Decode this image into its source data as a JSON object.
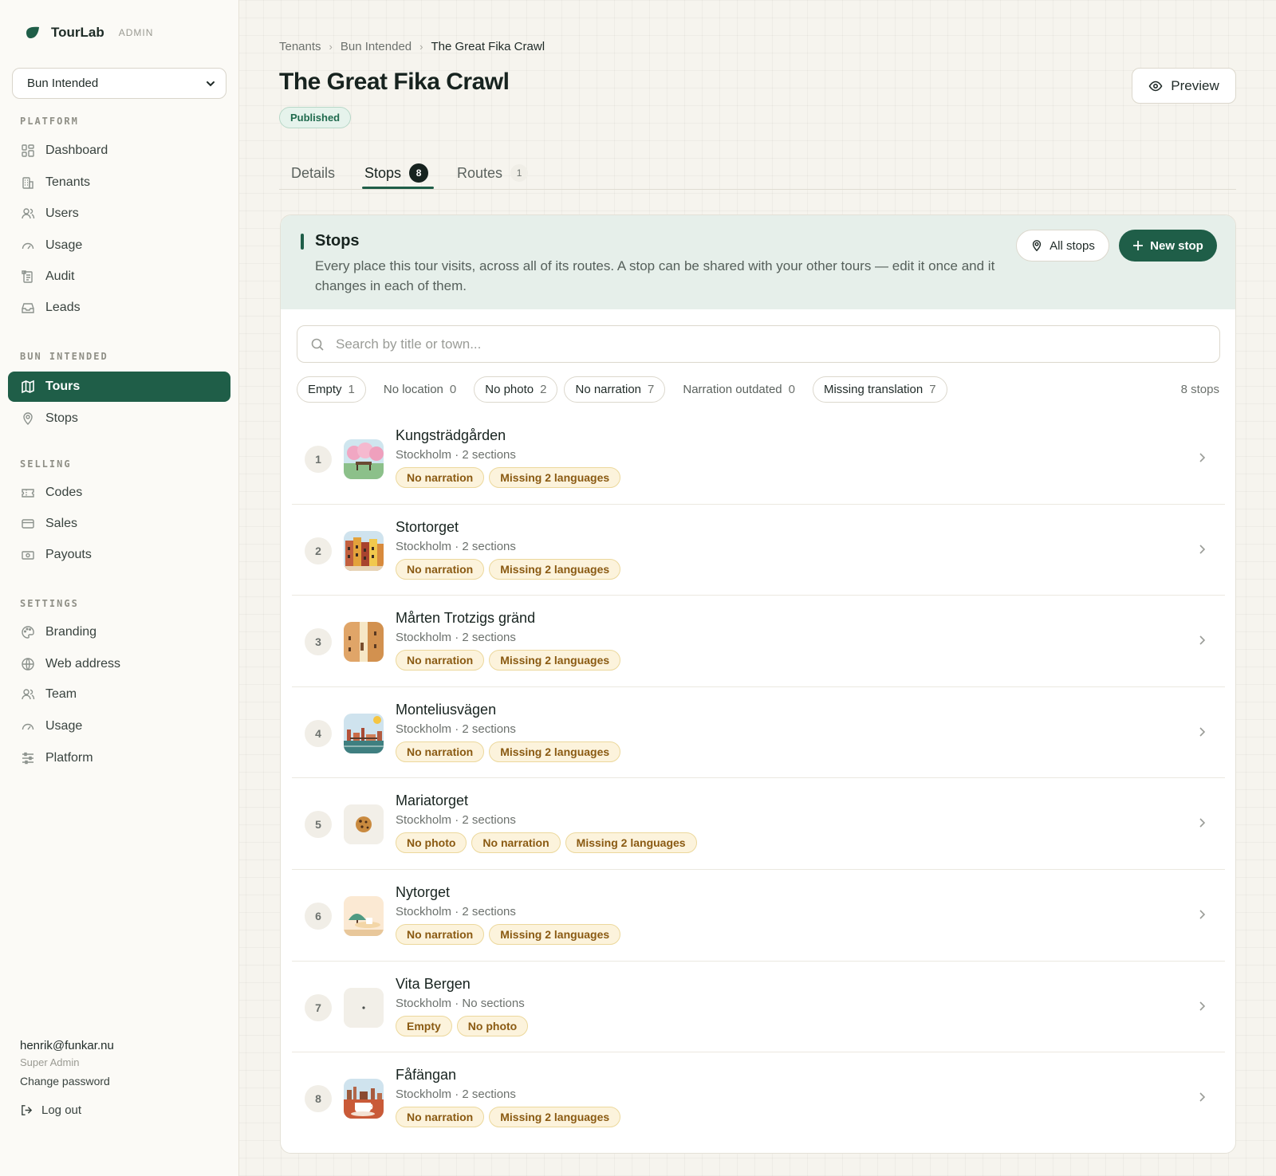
{
  "brand": {
    "name": "TourLab",
    "tag": "ADMIN"
  },
  "tenant_select": {
    "value": "Bun Intended"
  },
  "sidebar": {
    "sections": [
      {
        "label": "PLATFORM",
        "items": [
          {
            "label": "Dashboard",
            "icon": "dashboard-icon"
          },
          {
            "label": "Tenants",
            "icon": "building-icon"
          },
          {
            "label": "Users",
            "icon": "users-icon"
          },
          {
            "label": "Usage",
            "icon": "gauge-icon"
          },
          {
            "label": "Audit",
            "icon": "clipboard-icon"
          },
          {
            "label": "Leads",
            "icon": "inbox-icon"
          }
        ]
      },
      {
        "label": "BUN INTENDED",
        "items": [
          {
            "label": "Tours",
            "icon": "map-icon",
            "active": true
          },
          {
            "label": "Stops",
            "icon": "pin-icon"
          }
        ]
      },
      {
        "label": "SELLING",
        "items": [
          {
            "label": "Codes",
            "icon": "ticket-icon"
          },
          {
            "label": "Sales",
            "icon": "card-icon"
          },
          {
            "label": "Payouts",
            "icon": "banknote-icon"
          }
        ]
      },
      {
        "label": "SETTINGS",
        "items": [
          {
            "label": "Branding",
            "icon": "palette-icon"
          },
          {
            "label": "Web address",
            "icon": "globe-icon"
          },
          {
            "label": "Team",
            "icon": "users-icon"
          },
          {
            "label": "Usage",
            "icon": "gauge-icon"
          },
          {
            "label": "Platform",
            "icon": "sliders-icon"
          }
        ]
      }
    ]
  },
  "user": {
    "email": "henrik@funkar.nu",
    "role": "Super Admin",
    "change_password": "Change password",
    "logout": "Log out"
  },
  "breadcrumb": [
    "Tenants",
    "Bun Intended",
    "The Great Fika Crawl"
  ],
  "page": {
    "title": "The Great Fika Crawl",
    "status": "Published",
    "preview_label": "Preview"
  },
  "tabs": [
    {
      "label": "Details"
    },
    {
      "label": "Stops",
      "count": "8",
      "active": true
    },
    {
      "label": "Routes",
      "count": "1"
    }
  ],
  "stops_panel": {
    "title": "Stops",
    "description": "Every place this tour visits, across all of its routes. A stop can be shared with your other tours — edit it once and it changes in each of them.",
    "all_stops_label": "All stops",
    "new_stop_label": "New stop",
    "search_placeholder": "Search by title or town...",
    "filters": [
      {
        "label": "Empty",
        "count": "1",
        "outlined": true
      },
      {
        "label": "No location",
        "count": "0",
        "outlined": false
      },
      {
        "label": "No photo",
        "count": "2",
        "outlined": true
      },
      {
        "label": "No narration",
        "count": "7",
        "outlined": true
      },
      {
        "label": "Narration outdated",
        "count": "0",
        "outlined": false
      },
      {
        "label": "Missing translation",
        "count": "7",
        "outlined": true
      }
    ],
    "total_label": "8 stops",
    "stops": [
      {
        "num": "1",
        "title": "Kungsträdgården",
        "sub": "Stockholm · 2 sections",
        "thumb": "park-bench-thumb",
        "tags": [
          "No narration",
          "Missing 2 languages"
        ]
      },
      {
        "num": "2",
        "title": "Stortorget",
        "sub": "Stockholm · 2 sections",
        "thumb": "old-town-facades-thumb",
        "tags": [
          "No narration",
          "Missing 2 languages"
        ]
      },
      {
        "num": "3",
        "title": "Mårten Trotzigs gränd",
        "sub": "Stockholm · 2 sections",
        "thumb": "narrow-alley-thumb",
        "tags": [
          "No narration",
          "Missing 2 languages"
        ]
      },
      {
        "num": "4",
        "title": "Monteliusvägen",
        "sub": "Stockholm · 2 sections",
        "thumb": "waterfront-view-thumb",
        "tags": [
          "No narration",
          "Missing 2 languages"
        ]
      },
      {
        "num": "5",
        "title": "Mariatorget",
        "sub": "Stockholm · 2 sections",
        "thumb": "cookie-icon",
        "tags": [
          "No photo",
          "No narration",
          "Missing 2 languages"
        ]
      },
      {
        "num": "6",
        "title": "Nytorget",
        "sub": "Stockholm · 2 sections",
        "thumb": "cafe-table-thumb",
        "tags": [
          "No narration",
          "Missing 2 languages"
        ]
      },
      {
        "num": "7",
        "title": "Vita Bergen",
        "sub": "Stockholm · No sections",
        "thumb": "empty-thumb",
        "tags": [
          "Empty",
          "No photo"
        ]
      },
      {
        "num": "8",
        "title": "Fåfängan",
        "sub": "Stockholm · 2 sections",
        "thumb": "coffee-skyline-thumb",
        "tags": [
          "No narration",
          "Missing 2 languages"
        ]
      }
    ]
  },
  "colors": {
    "accent": "#1f5e48",
    "warn_bg": "#fcf3dc",
    "warn_text": "#8a5a12",
    "panel_head": "#e6efea"
  }
}
